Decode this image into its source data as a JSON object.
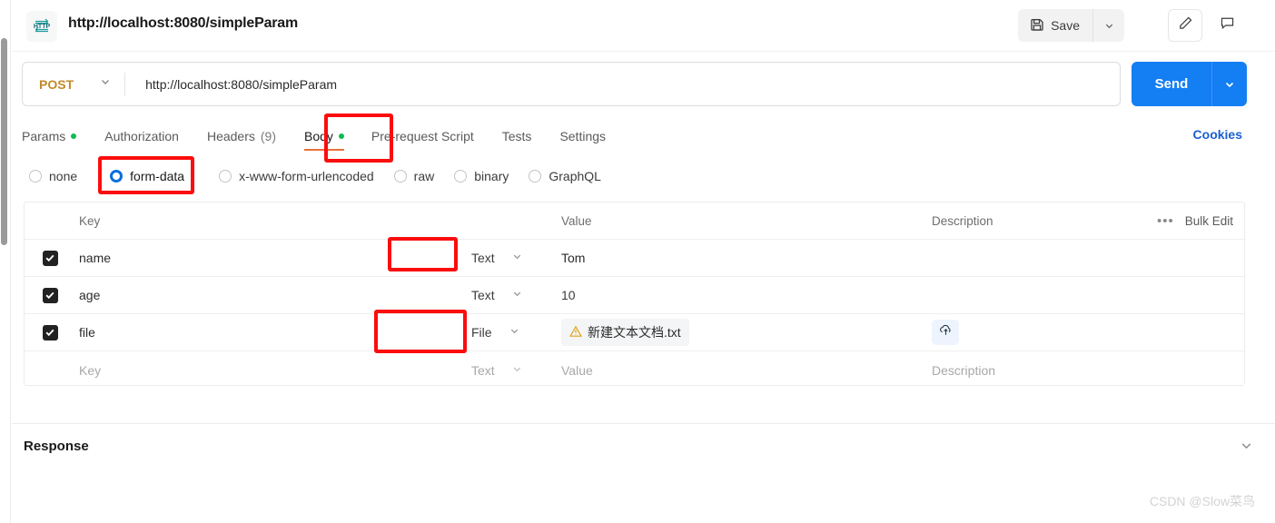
{
  "header": {
    "icon": "http-protocol-icon",
    "tab_title": "http://localhost:8080/simpleParam",
    "save_label": "Save",
    "save_icon": "floppy-disk-icon",
    "save_caret_icon": "chevron-down-icon",
    "pencil_icon": "pencil-edit-icon",
    "comment_icon": "comment-icon"
  },
  "request": {
    "method": "POST",
    "method_caret_icon": "chevron-down-icon",
    "url": "http://localhost:8080/simpleParam",
    "send_label": "Send",
    "send_caret_icon": "chevron-down-icon"
  },
  "tabs": [
    {
      "label": "Params",
      "dot": true,
      "count": "",
      "active": false
    },
    {
      "label": "Authorization",
      "dot": false,
      "count": "",
      "active": false
    },
    {
      "label": "Headers",
      "dot": false,
      "count": "(9)",
      "active": false
    },
    {
      "label": "Body",
      "dot": true,
      "count": "",
      "active": true
    },
    {
      "label": "Pre-request Script",
      "dot": false,
      "count": "",
      "active": false
    },
    {
      "label": "Tests",
      "dot": false,
      "count": "",
      "active": false
    },
    {
      "label": "Settings",
      "dot": false,
      "count": "",
      "active": false
    }
  ],
  "cookies_label": "Cookies",
  "body_types": [
    {
      "label": "none",
      "selected": false
    },
    {
      "label": "form-data",
      "selected": true
    },
    {
      "label": "x-www-form-urlencoded",
      "selected": false
    },
    {
      "label": "raw",
      "selected": false
    },
    {
      "label": "binary",
      "selected": false
    },
    {
      "label": "GraphQL",
      "selected": false
    }
  ],
  "table": {
    "columns": {
      "key": "Key",
      "value": "Value",
      "description": "Description"
    },
    "dots_icon": "more-options-icon",
    "bulk_edit_label": "Bulk Edit",
    "rows": [
      {
        "checked": true,
        "key": "name",
        "type": "Text",
        "value": "Tom",
        "value_kind": "text",
        "description": ""
      },
      {
        "checked": true,
        "key": "age",
        "type": "Text",
        "value": "10",
        "value_kind": "text",
        "description": ""
      },
      {
        "checked": true,
        "key": "file",
        "type": "File",
        "value": "新建文本文档.txt",
        "value_kind": "file",
        "description": "",
        "file_warning_icon": "warning-triangle-icon",
        "upload_icon": "cloud-upload-icon"
      }
    ],
    "empty_row": {
      "key_placeholder": "Key",
      "type_placeholder": "Text",
      "value_placeholder": "Value",
      "description_placeholder": "Description"
    }
  },
  "response": {
    "title": "Response",
    "caret_icon": "chevron-down-icon"
  },
  "watermark": "CSDN @Slow菜鸟",
  "colors": {
    "send_blue": "#147ef3",
    "method_orange": "#c18a2a",
    "active_tab_underline": "#e8713a",
    "status_dot_green": "#0cbb52",
    "annotation_red": "#fb0d0d",
    "cookies_blue": "#1a5fd0"
  }
}
